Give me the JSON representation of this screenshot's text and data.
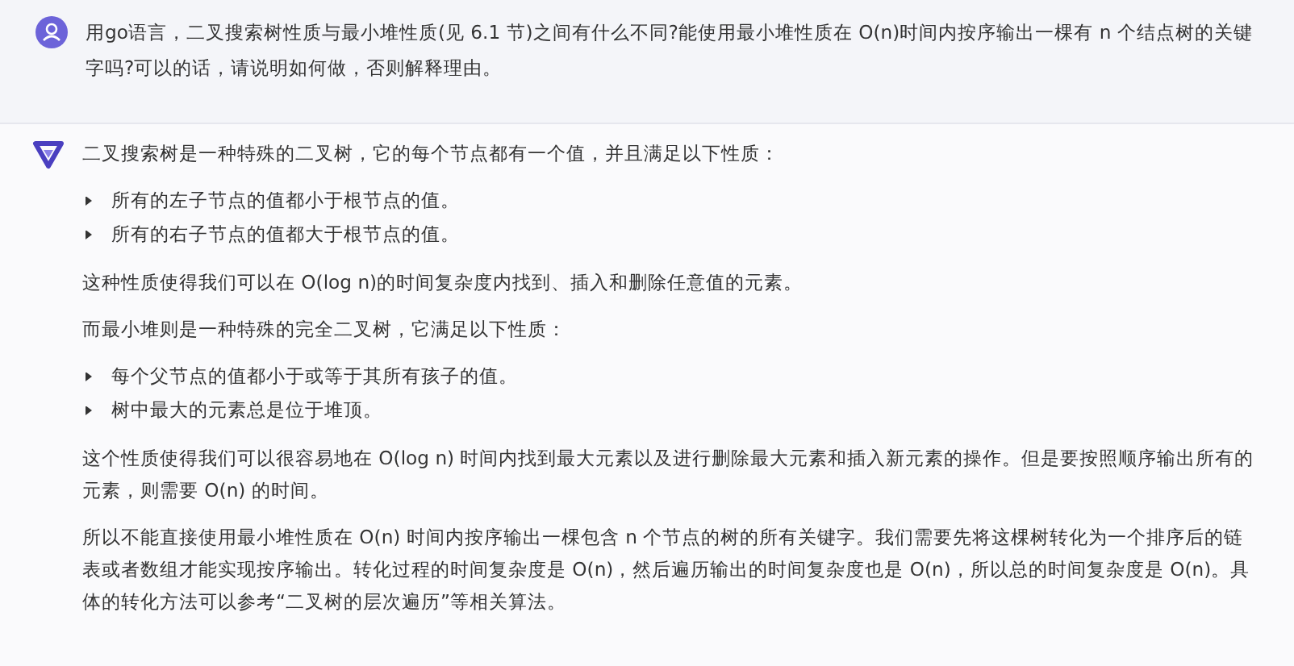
{
  "question": {
    "text": "用go语言，二叉搜索树性质与最小堆性质(见 6.1 节)之间有什么不同?能使用最小堆性质在 O(n)时间内按序输出一棵有 n 个结点树的关键字吗?可以的话，请说明如何做，否则解释理由。"
  },
  "answer": {
    "blocks": [
      {
        "kind": "paragraph",
        "text": "二叉搜索树是一种特殊的二叉树，它的每个节点都有一个值，并且满足以下性质："
      },
      {
        "kind": "bullets",
        "items": [
          "所有的左子节点的值都小于根节点的值。",
          "所有的右子节点的值都大于根节点的值。"
        ]
      },
      {
        "kind": "paragraph",
        "text": "这种性质使得我们可以在 O(log n)的时间复杂度内找到、插入和删除任意值的元素。"
      },
      {
        "kind": "paragraph",
        "text": "而最小堆则是一种特殊的完全二叉树，它满足以下性质："
      },
      {
        "kind": "bullets",
        "items": [
          "每个父节点的值都小于或等于其所有孩子的值。",
          "树中最大的元素总是位于堆顶。"
        ]
      },
      {
        "kind": "paragraph",
        "text": "这个性质使得我们可以很容易地在 O(log n) 时间内找到最大元素以及进行删除最大元素和插入新元素的操作。但是要按照顺序输出所有的元素，则需要 O(n) 的时间。"
      },
      {
        "kind": "paragraph",
        "text": "所以不能直接使用最小堆性质在 O(n) 时间内按序输出一棵包含 n 个节点的树的所有关键字。我们需要先将这棵树转化为一个排序后的链表或者数组才能实现按序输出。转化过程的时间复杂度是 O(n)，然后遍历输出的时间复杂度也是 O(n)，所以总的时间复杂度是 O(n)。具体的转化方法可以参考“二叉树的层次遍历”等相关算法。"
      }
    ]
  }
}
